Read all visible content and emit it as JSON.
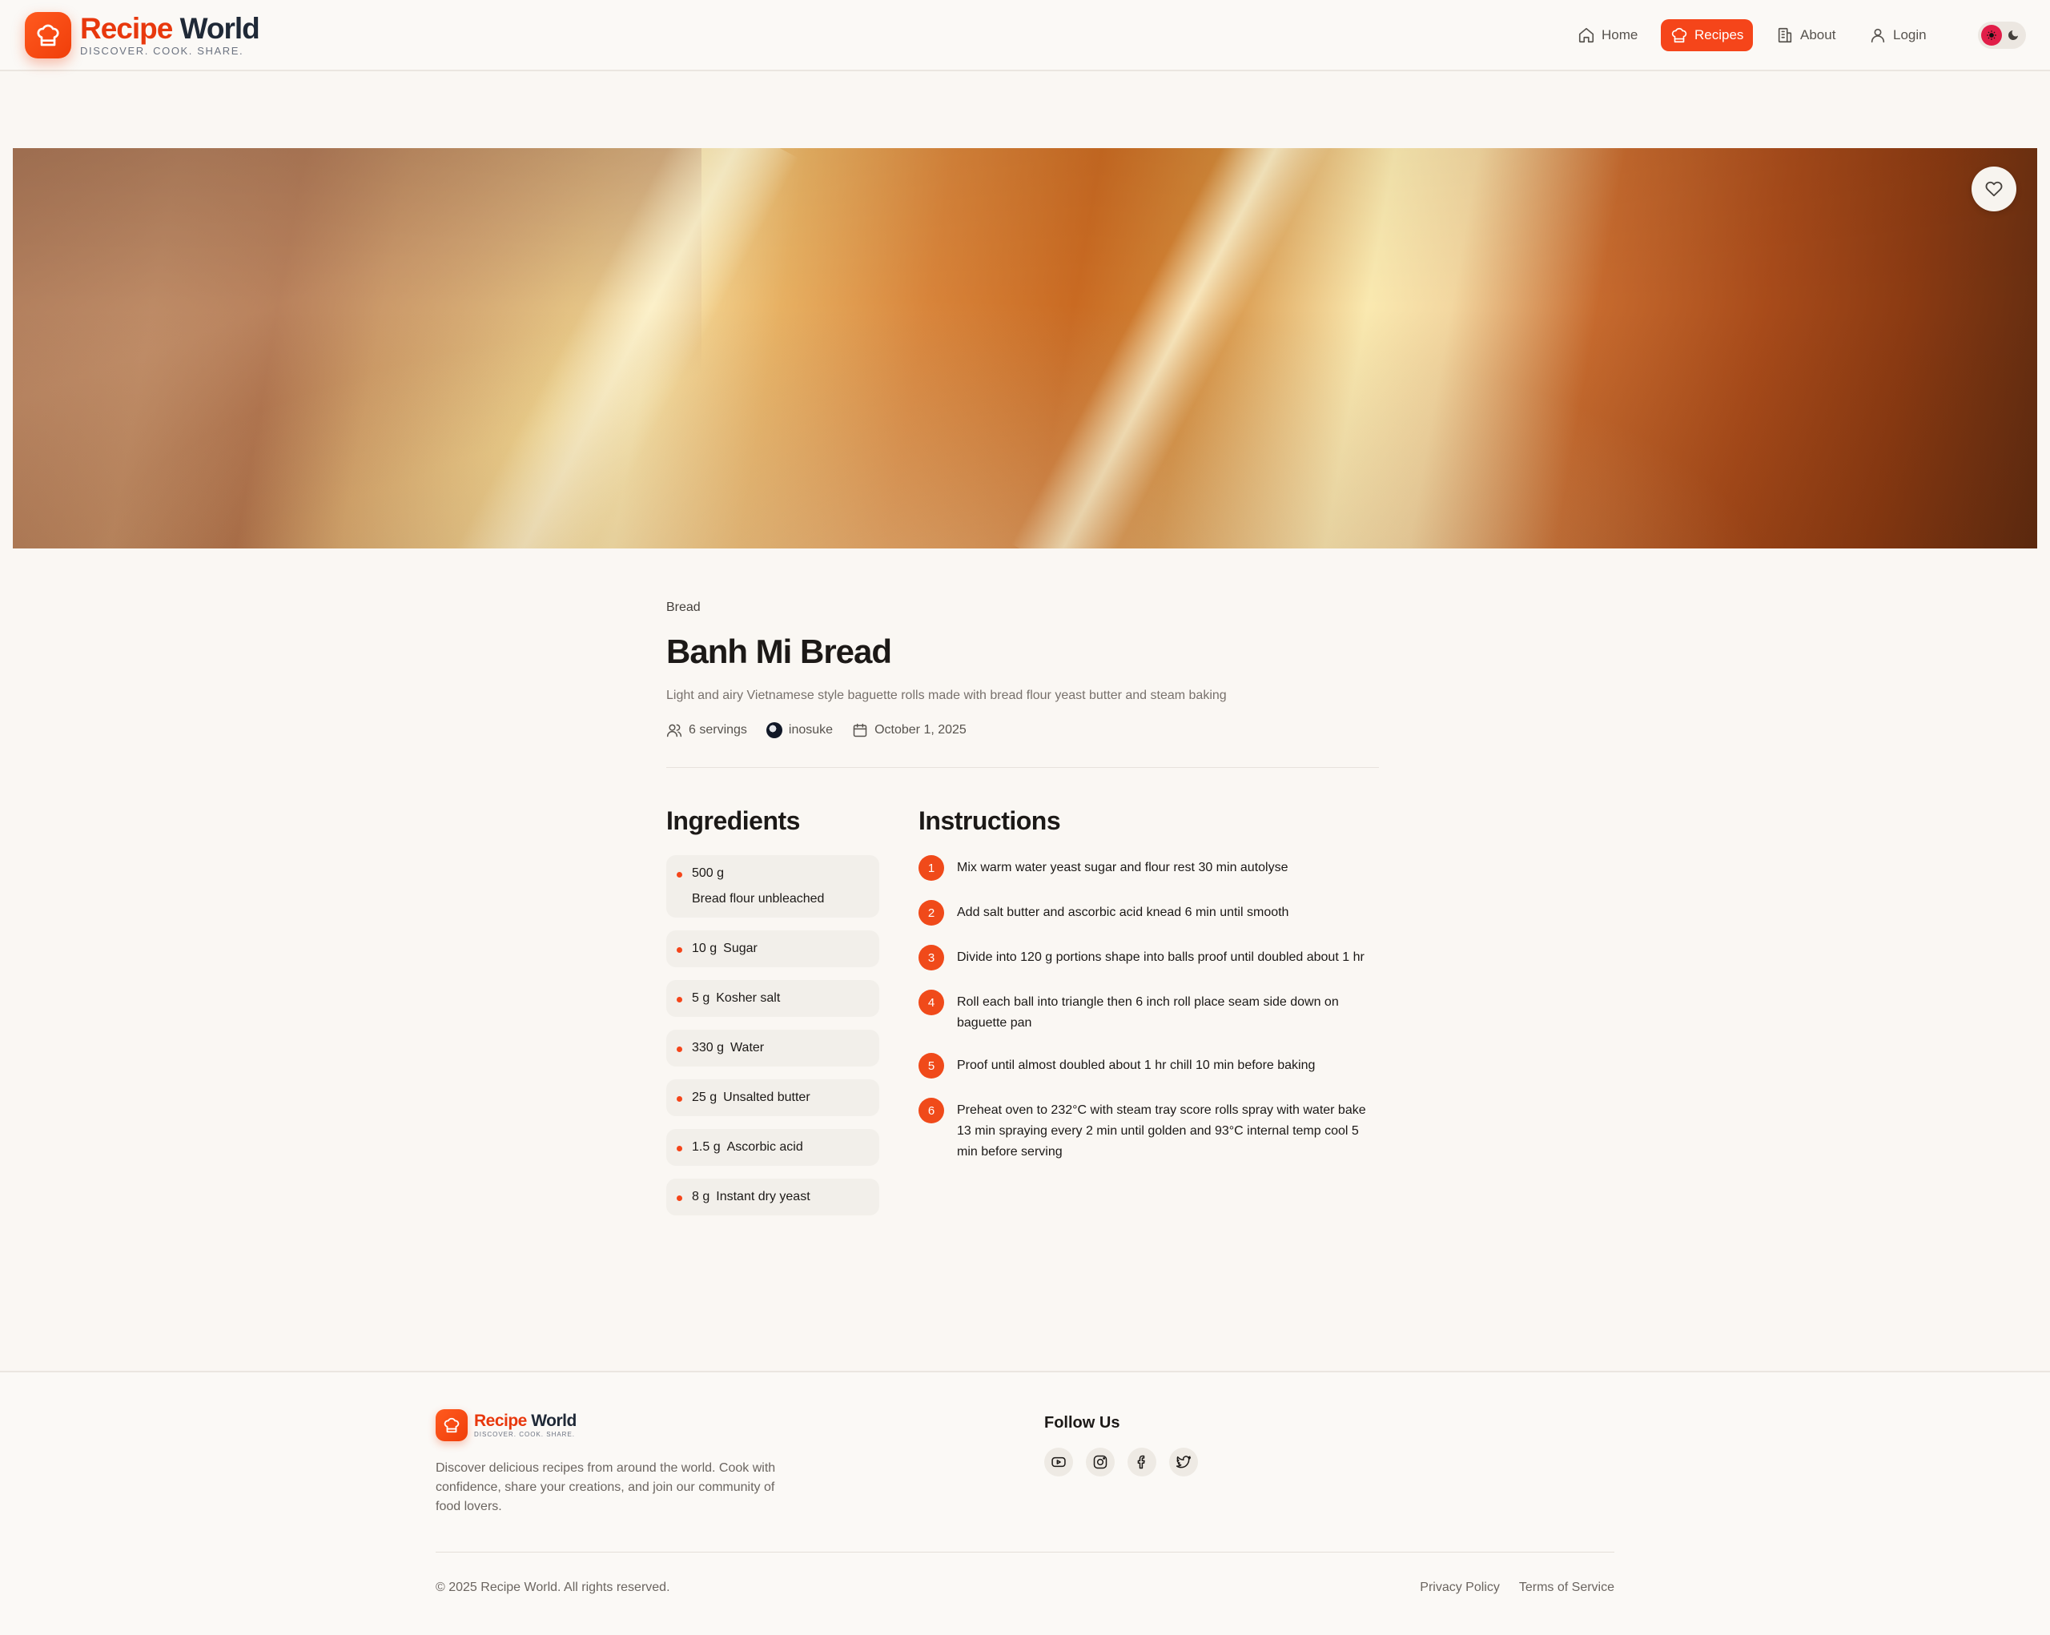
{
  "header": {
    "logo_word1": "Recipe",
    "logo_word2": "World",
    "tagline": "DISCOVER. COOK. SHARE.",
    "nav": [
      {
        "label": "Home",
        "icon": "home-icon",
        "active": false
      },
      {
        "label": "Recipes",
        "icon": "chef-hat-icon",
        "active": true
      },
      {
        "label": "About",
        "icon": "building-icon",
        "active": false
      },
      {
        "label": "Login",
        "icon": "user-icon",
        "active": false
      }
    ]
  },
  "recipe": {
    "category": "Bread",
    "title": "Banh Mi Bread",
    "description": "Light and airy Vietnamese style baguette rolls made with bread flour yeast butter and steam baking",
    "servings": "6 servings",
    "author": "inosuke",
    "date": "October 1, 2025"
  },
  "ingredients": {
    "heading": "Ingredients",
    "items": [
      {
        "qty": "500 g",
        "name": "Bread flour unbleached"
      },
      {
        "qty": "10 g",
        "name": "Sugar"
      },
      {
        "qty": "5 g",
        "name": "Kosher salt"
      },
      {
        "qty": "330 g",
        "name": "Water"
      },
      {
        "qty": "25 g",
        "name": "Unsalted butter"
      },
      {
        "qty": "1.5 g",
        "name": "Ascorbic acid"
      },
      {
        "qty": "8 g",
        "name": "Instant dry yeast"
      }
    ]
  },
  "instructions": {
    "heading": "Instructions",
    "steps": [
      {
        "num": "1",
        "text": "Mix warm water yeast sugar and flour rest 30 min autolyse"
      },
      {
        "num": "2",
        "text": "Add salt butter and ascorbic acid knead 6 min until smooth"
      },
      {
        "num": "3",
        "text": "Divide into 120 g portions shape into balls proof until doubled about 1 hr"
      },
      {
        "num": "4",
        "text": "Roll each ball into triangle then 6 inch roll place seam side down on baguette pan"
      },
      {
        "num": "5",
        "text": "Proof until almost doubled about 1 hr chill 10 min before baking"
      },
      {
        "num": "6",
        "text": "Preheat oven to 232°C with steam tray score rolls spray with water bake 13 min spraying every 2 min until golden and 93°C internal temp cool 5 min before serving"
      }
    ]
  },
  "footer": {
    "logo_word1": "Recipe",
    "logo_word2": "World",
    "tagline": "DISCOVER. COOK. SHARE.",
    "description": "Discover delicious recipes from around the world. Cook with confidence, share your creations, and join our community of food lovers.",
    "follow_heading": "Follow Us",
    "socials": [
      "youtube-icon",
      "instagram-icon",
      "facebook-icon",
      "twitter-icon"
    ],
    "copyright": "© 2025 Recipe World. All rights reserved.",
    "privacy": "Privacy Policy",
    "terms": "Terms of Service"
  },
  "colors": {
    "accent": "#f5451a",
    "background": "#faf7f3",
    "text": "#1c1917"
  }
}
